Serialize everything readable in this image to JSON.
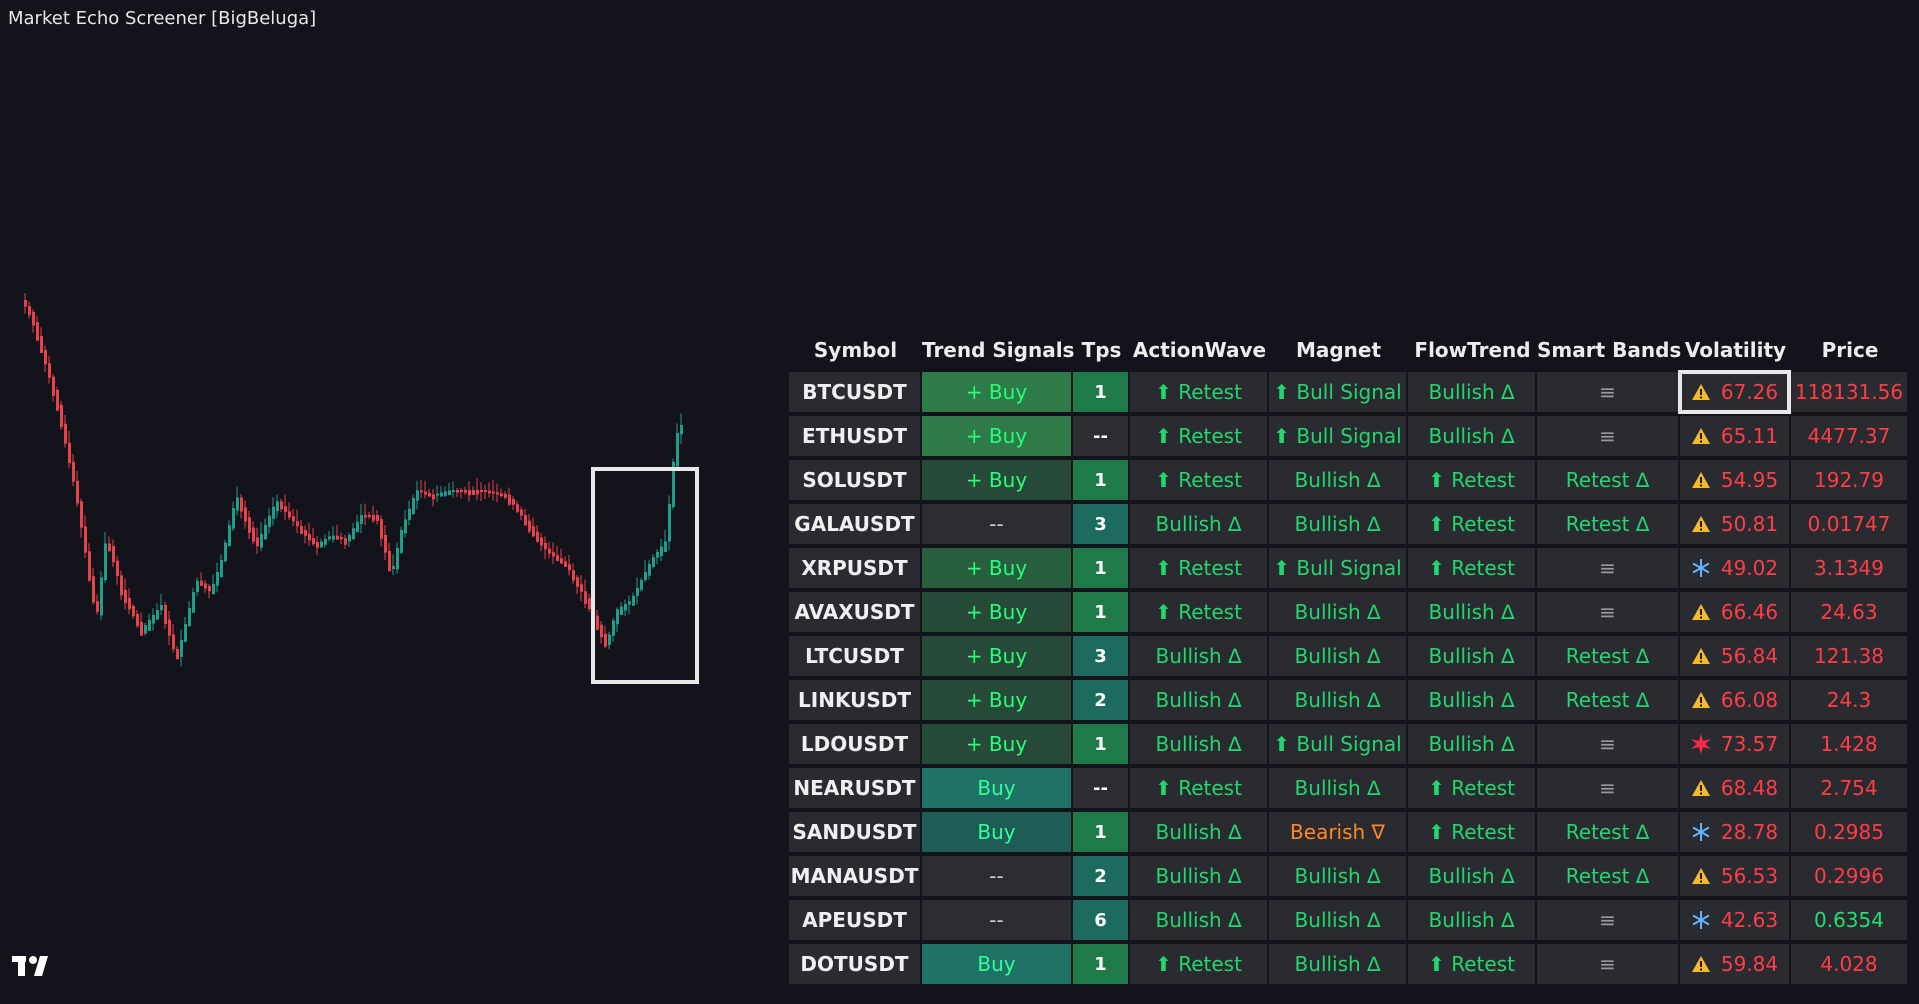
{
  "app_title": "Market Echo Screener [BigBeluga]",
  "icons": {
    "warning": "warning-triangle-icon",
    "cold": "snowflake-icon",
    "spike": "explosion-icon",
    "logo": "tradingview-logo"
  },
  "colors": {
    "background": "#12131b",
    "bull": "#22d76d",
    "bear": "#ff3d45",
    "orange": "#ff8a1f",
    "candle_up": "#1f9e8a",
    "candle_down": "#e8424a"
  },
  "screener": {
    "headers": [
      "Symbol",
      "Trend Signals",
      "Tps",
      "ActionWave",
      "Magnet",
      "FlowTrend",
      "Smart Bands",
      "Volatility",
      "Price"
    ],
    "rows": [
      {
        "symbol": "BTCUSDT",
        "trend": "+ Buy",
        "tps": "1",
        "actionwave": "⬆ Retest",
        "magnet": "⬆ Bull Signal",
        "flowtrend": "Bullish ∆",
        "smartbands": "≡",
        "vol_icon": "warning",
        "volatility": "67.26",
        "price": "118131.56"
      },
      {
        "symbol": "ETHUSDT",
        "trend": "+ Buy",
        "tps": "--",
        "actionwave": "⬆ Retest",
        "magnet": "⬆ Bull Signal",
        "flowtrend": "Bullish ∆",
        "smartbands": "≡",
        "vol_icon": "warning",
        "volatility": "65.11",
        "price": "4477.37"
      },
      {
        "symbol": "SOLUSDT",
        "trend": "+ Buy",
        "tps": "1",
        "actionwave": "⬆ Retest",
        "magnet": "Bullish ∆",
        "flowtrend": "⬆ Retest",
        "smartbands": "Retest ∆",
        "vol_icon": "warning",
        "volatility": "54.95",
        "price": "192.79"
      },
      {
        "symbol": "GALAUSDT",
        "trend": "--",
        "tps": "3",
        "actionwave": "Bullish ∆",
        "magnet": "Bullish ∆",
        "flowtrend": "⬆ Retest",
        "smartbands": "Retest ∆",
        "vol_icon": "warning",
        "volatility": "50.81",
        "price": "0.01747"
      },
      {
        "symbol": "XRPUSDT",
        "trend": "+ Buy",
        "tps": "1",
        "actionwave": "⬆ Retest",
        "magnet": "⬆ Bull Signal",
        "flowtrend": "⬆ Retest",
        "smartbands": "≡",
        "vol_icon": "cold",
        "volatility": "49.02",
        "price": "3.1349"
      },
      {
        "symbol": "AVAXUSDT",
        "trend": "+ Buy",
        "tps": "1",
        "actionwave": "⬆ Retest",
        "magnet": "Bullish ∆",
        "flowtrend": "Bullish ∆",
        "smartbands": "≡",
        "vol_icon": "warning",
        "volatility": "66.46",
        "price": "24.63"
      },
      {
        "symbol": "LTCUSDT",
        "trend": "+ Buy",
        "tps": "3",
        "actionwave": "Bullish ∆",
        "magnet": "Bullish ∆",
        "flowtrend": "Bullish ∆",
        "smartbands": "Retest ∆",
        "vol_icon": "warning",
        "volatility": "56.84",
        "price": "121.38"
      },
      {
        "symbol": "LINKUSDT",
        "trend": "+ Buy",
        "tps": "2",
        "actionwave": "Bullish ∆",
        "magnet": "Bullish ∆",
        "flowtrend": "Bullish ∆",
        "smartbands": "Retest ∆",
        "vol_icon": "warning",
        "volatility": "66.08",
        "price": "24.3"
      },
      {
        "symbol": "LDOUSDT",
        "trend": "+ Buy",
        "tps": "1",
        "actionwave": "Bullish ∆",
        "magnet": "⬆ Bull Signal",
        "flowtrend": "Bullish ∆",
        "smartbands": "≡",
        "vol_icon": "spike",
        "volatility": "73.57",
        "price": "1.428"
      },
      {
        "symbol": "NEARUSDT",
        "trend": "Buy",
        "tps": "--",
        "actionwave": "⬆ Retest",
        "magnet": "Bullish ∆",
        "flowtrend": "⬆ Retest",
        "smartbands": "≡",
        "vol_icon": "warning",
        "volatility": "68.48",
        "price": "2.754"
      },
      {
        "symbol": "SANDUSDT",
        "trend": "Buy",
        "tps": "1",
        "actionwave": "Bullish ∆",
        "magnet": "Bearish ∇",
        "flowtrend": "⬆ Retest",
        "smartbands": "Retest ∆",
        "vol_icon": "cold",
        "volatility": "28.78",
        "price": "0.2985"
      },
      {
        "symbol": "MANAUSDT",
        "trend": "--",
        "tps": "2",
        "actionwave": "Bullish ∆",
        "magnet": "Bullish ∆",
        "flowtrend": "Bullish ∆",
        "smartbands": "Retest ∆",
        "vol_icon": "warning",
        "volatility": "56.53",
        "price": "0.2996"
      },
      {
        "symbol": "APEUSDT",
        "trend": "--",
        "tps": "6",
        "actionwave": "Bullish ∆",
        "magnet": "Bullish ∆",
        "flowtrend": "Bullish ∆",
        "smartbands": "≡",
        "vol_icon": "cold",
        "volatility": "42.63",
        "price": "0.6354"
      },
      {
        "symbol": "DOTUSDT",
        "trend": "Buy",
        "tps": "1",
        "actionwave": "⬆ Retest",
        "magnet": "Bullish ∆",
        "flowtrend": "⬆ Retest",
        "smartbands": "≡",
        "vol_icon": "warning",
        "volatility": "59.84",
        "price": "4.028"
      }
    ]
  }
}
